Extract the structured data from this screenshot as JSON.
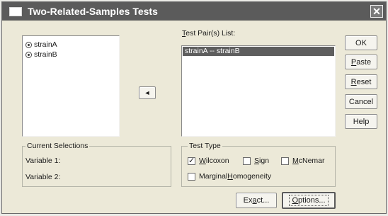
{
  "window": {
    "title": "Two-Related-Samples Tests",
    "close_symbol": "✕"
  },
  "variables": {
    "items": [
      {
        "label": "strainA",
        "icon": "scale-variable-icon"
      },
      {
        "label": "strainB",
        "icon": "scale-variable-icon"
      }
    ]
  },
  "move_button": {
    "symbol": "◄"
  },
  "test_pairs": {
    "label": "Test Pair(s) List:",
    "label_mnemonic": "T",
    "label_rest": "est Pair(s) List:",
    "items": [
      "strainA -- strainB"
    ]
  },
  "side_buttons": [
    {
      "label": "OK",
      "mnemonic": "",
      "rest": "OK"
    },
    {
      "label": "Paste",
      "mnemonic": "P",
      "rest": "aste"
    },
    {
      "label": "Reset",
      "mnemonic": "R",
      "rest": "eset"
    },
    {
      "label": "Cancel",
      "mnemonic": "",
      "rest": "Cancel"
    },
    {
      "label": "Help",
      "mnemonic": "",
      "rest": "Help"
    }
  ],
  "current_selections": {
    "legend": "Current Selections",
    "variable1_label": "Variable 1:",
    "variable2_label": "Variable 2:"
  },
  "test_type": {
    "legend": "Test Type",
    "wilcoxon": {
      "label": "Wilcoxon",
      "mnemonic": "W",
      "rest": "ilcoxon",
      "checked": true
    },
    "sign": {
      "label": "Sign",
      "mnemonic": "S",
      "rest": "ign",
      "checked": false
    },
    "mcnemar": {
      "label": "McNemar",
      "mnemonic": "M",
      "rest": "cNemar",
      "checked": false
    },
    "marginal": {
      "label": "Marginal Homogeneity",
      "pre": "Marginal ",
      "mnemonic": "H",
      "rest": "omogeneity",
      "checked": false
    }
  },
  "bottom_buttons": {
    "exact": {
      "label": "Exact...",
      "pre": "Ex",
      "mnemonic": "a",
      "rest": "ct..."
    },
    "options": {
      "label": "Options...",
      "mnemonic": "O",
      "rest": "ptions..."
    }
  }
}
